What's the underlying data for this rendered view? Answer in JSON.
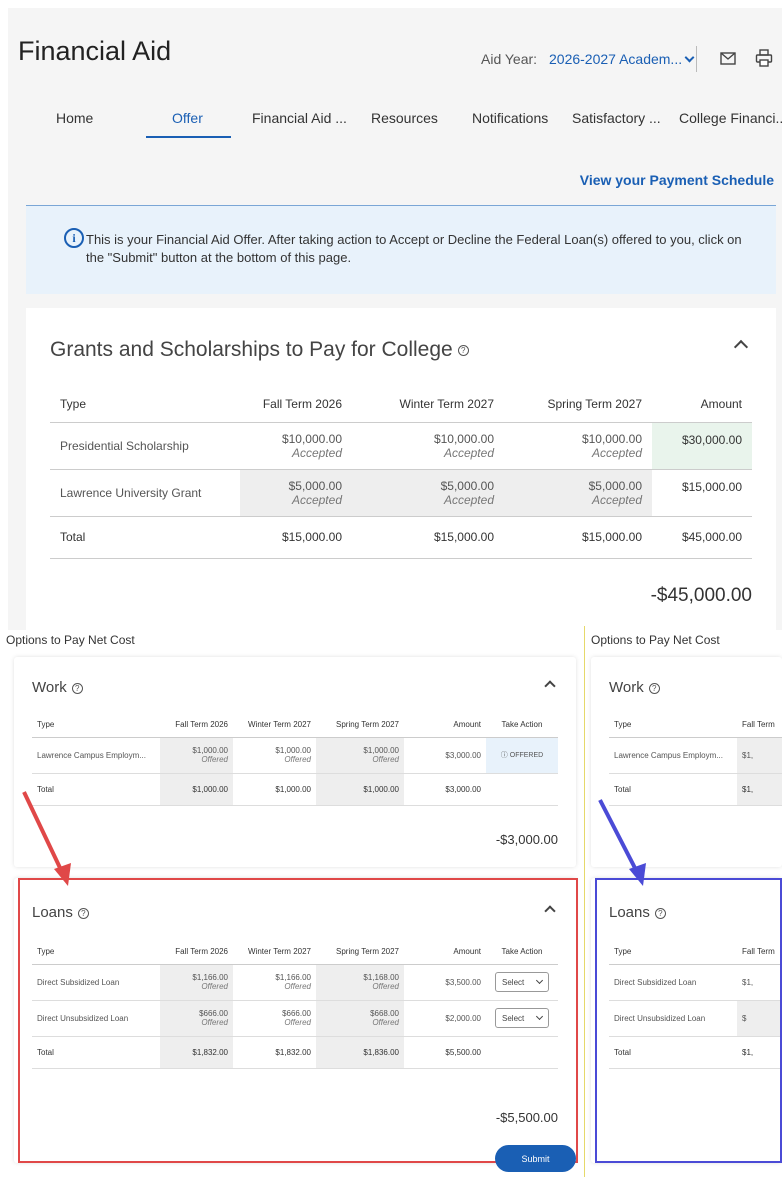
{
  "header": {
    "title": "Financial Aid",
    "aid_year_label": "Aid Year:",
    "aid_year_value": "2026-2027 Academ...",
    "mail_icon": "mail-icon",
    "print_icon": "print-icon"
  },
  "nav": {
    "tabs": [
      {
        "label": "Home"
      },
      {
        "label": "Offer",
        "active": true
      },
      {
        "label": "Financial Aid ..."
      },
      {
        "label": "Resources"
      },
      {
        "label": "Notifications"
      },
      {
        "label": "Satisfactory ..."
      },
      {
        "label": "College Financi..."
      }
    ]
  },
  "payment_link": "View your Payment Schedule",
  "banner": {
    "text": "This is your Financial Aid Offer. After taking action to Accept or Decline the Federal Loan(s) offered to you, click on the \"Submit\" button at the bottom of this page."
  },
  "grants": {
    "title": "Grants and Scholarships to Pay for College",
    "headers": [
      "Type",
      "Fall Term 2026",
      "Winter Term 2027",
      "Spring Term 2027",
      "Amount"
    ],
    "rows": [
      {
        "type": "Presidential Scholarship",
        "fall": "$10,000.00",
        "fall_status": "Accepted",
        "winter": "$10,000.00",
        "winter_status": "Accepted",
        "spring": "$10,000.00",
        "spring_status": "Accepted",
        "amount": "$30,000.00"
      },
      {
        "type": "Lawrence University Grant",
        "fall": "$5,000.00",
        "fall_status": "Accepted",
        "winter": "$5,000.00",
        "winter_status": "Accepted",
        "spring": "$5,000.00",
        "spring_status": "Accepted",
        "amount": "$15,000.00"
      }
    ],
    "total": {
      "label": "Total",
      "fall": "$15,000.00",
      "winter": "$15,000.00",
      "spring": "$15,000.00",
      "amount": "$45,000.00"
    },
    "net": "-$45,000.00"
  },
  "options_label": "Options to Pay Net Cost",
  "work": {
    "title": "Work",
    "headers": [
      "Type",
      "Fall Term 2026",
      "Winter Term 2027",
      "Spring Term 2027",
      "Amount",
      "Take Action"
    ],
    "rows": [
      {
        "type": "Lawrence Campus Employm...",
        "fall": "$1,000.00",
        "fall_status": "Offered",
        "winter": "$1,000.00",
        "winter_status": "Offered",
        "spring": "$1,000.00",
        "spring_status": "Offered",
        "amount": "$3,000.00",
        "action": "OFFERED"
      }
    ],
    "total": {
      "label": "Total",
      "fall": "$1,000.00",
      "winter": "$1,000.00",
      "spring": "$1,000.00",
      "amount": "$3,000.00"
    },
    "net": "-$3,000.00"
  },
  "loans": {
    "title": "Loans",
    "headers": [
      "Type",
      "Fall Term 2026",
      "Winter Term 2027",
      "Spring Term 2027",
      "Amount",
      "Take Action"
    ],
    "rows": [
      {
        "type": "Direct Subsidized Loan",
        "fall": "$1,166.00",
        "fall_status": "Offered",
        "winter": "$1,166.00",
        "winter_status": "Offered",
        "spring": "$1,168.00",
        "spring_status": "Offered",
        "amount": "$3,500.00",
        "action": "Select"
      },
      {
        "type": "Direct Unsubsidized Loan",
        "fall": "$666.00",
        "fall_status": "Offered",
        "winter": "$666.00",
        "winter_status": "Offered",
        "spring": "$668.00",
        "spring_status": "Offered",
        "amount": "$2,000.00",
        "action": "Select"
      }
    ],
    "total": {
      "label": "Total",
      "fall": "$1,832.00",
      "winter": "$1,832.00",
      "spring": "$1,836.00",
      "amount": "$5,500.00"
    },
    "net": "-$5,500.00"
  },
  "right_panel": {
    "fall_header": "Fall Term",
    "work_row": {
      "type": "Lawrence Campus Employm...",
      "fall": "$1,"
    },
    "work_total": {
      "label": "Total",
      "fall": "$1,"
    },
    "loan_rows": [
      {
        "type": "Direct Subsidized Loan",
        "fall": "$1,"
      },
      {
        "type": "Direct Unsubsidized Loan",
        "fall": "$"
      }
    ],
    "loan_total": {
      "label": "Total",
      "fall": "$1,"
    }
  },
  "submit_label": "Submit",
  "colors": {
    "brand": "#1a5fb4",
    "highlight_red": "#e04848",
    "highlight_blue": "#4b4bd6",
    "arrow_red": "#e04848",
    "arrow_blue": "#4b4bd6"
  }
}
